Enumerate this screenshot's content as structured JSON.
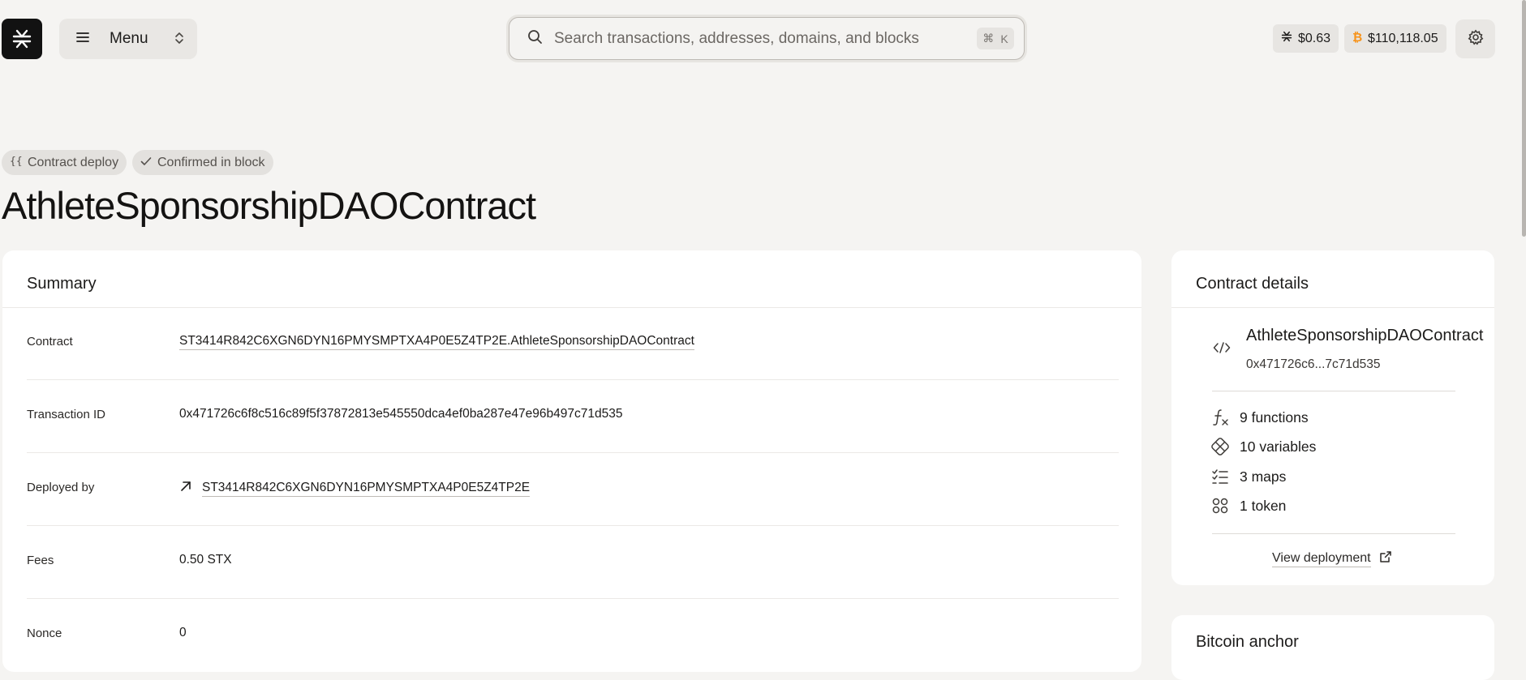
{
  "header": {
    "logo_icon": "stacks-logo-icon",
    "menu_label": "Menu",
    "search_placeholder": "Search transactions, addresses, domains, and blocks",
    "search_shortcut_symbol": "⌘",
    "search_shortcut_key": "K",
    "stx_price": "$0.63",
    "btc_price": "$110,118.05",
    "btc_color": "#f7931a"
  },
  "badges": {
    "contract_deploy": "Contract deploy",
    "confirmed": "Confirmed in block"
  },
  "page_title": "AthleteSponsorshipDAOContract",
  "summary": {
    "heading": "Summary",
    "rows": [
      {
        "label": "Contract",
        "value": "ST3414R842C6XGN6DYN16PMYSMPTXA4P0E5Z4TP2E.AthleteSponsorshipDAOContract"
      },
      {
        "label": "Transaction ID",
        "value": "0x471726c6f8c516c89f5f37872813e545550dca4ef0ba287e47e96b497c71d535"
      },
      {
        "label": "Deployed by",
        "value": "ST3414R842C6XGN6DYN16PMYSMPTXA4P0E5Z4TP2E"
      },
      {
        "label": "Fees",
        "value": "0.50 STX"
      },
      {
        "label": "Nonce",
        "value": "0"
      }
    ]
  },
  "contract_details": {
    "heading": "Contract details",
    "name": "AthleteSponsorshipDAOContract",
    "short_hash": "0x471726c6...7c71d535",
    "stats": {
      "functions": "9 functions",
      "variables": "10 variables",
      "maps": "3 maps",
      "tokens": "1 token"
    },
    "view_deployment": "View deployment"
  },
  "bitcoin_anchor": {
    "heading": "Bitcoin anchor"
  }
}
